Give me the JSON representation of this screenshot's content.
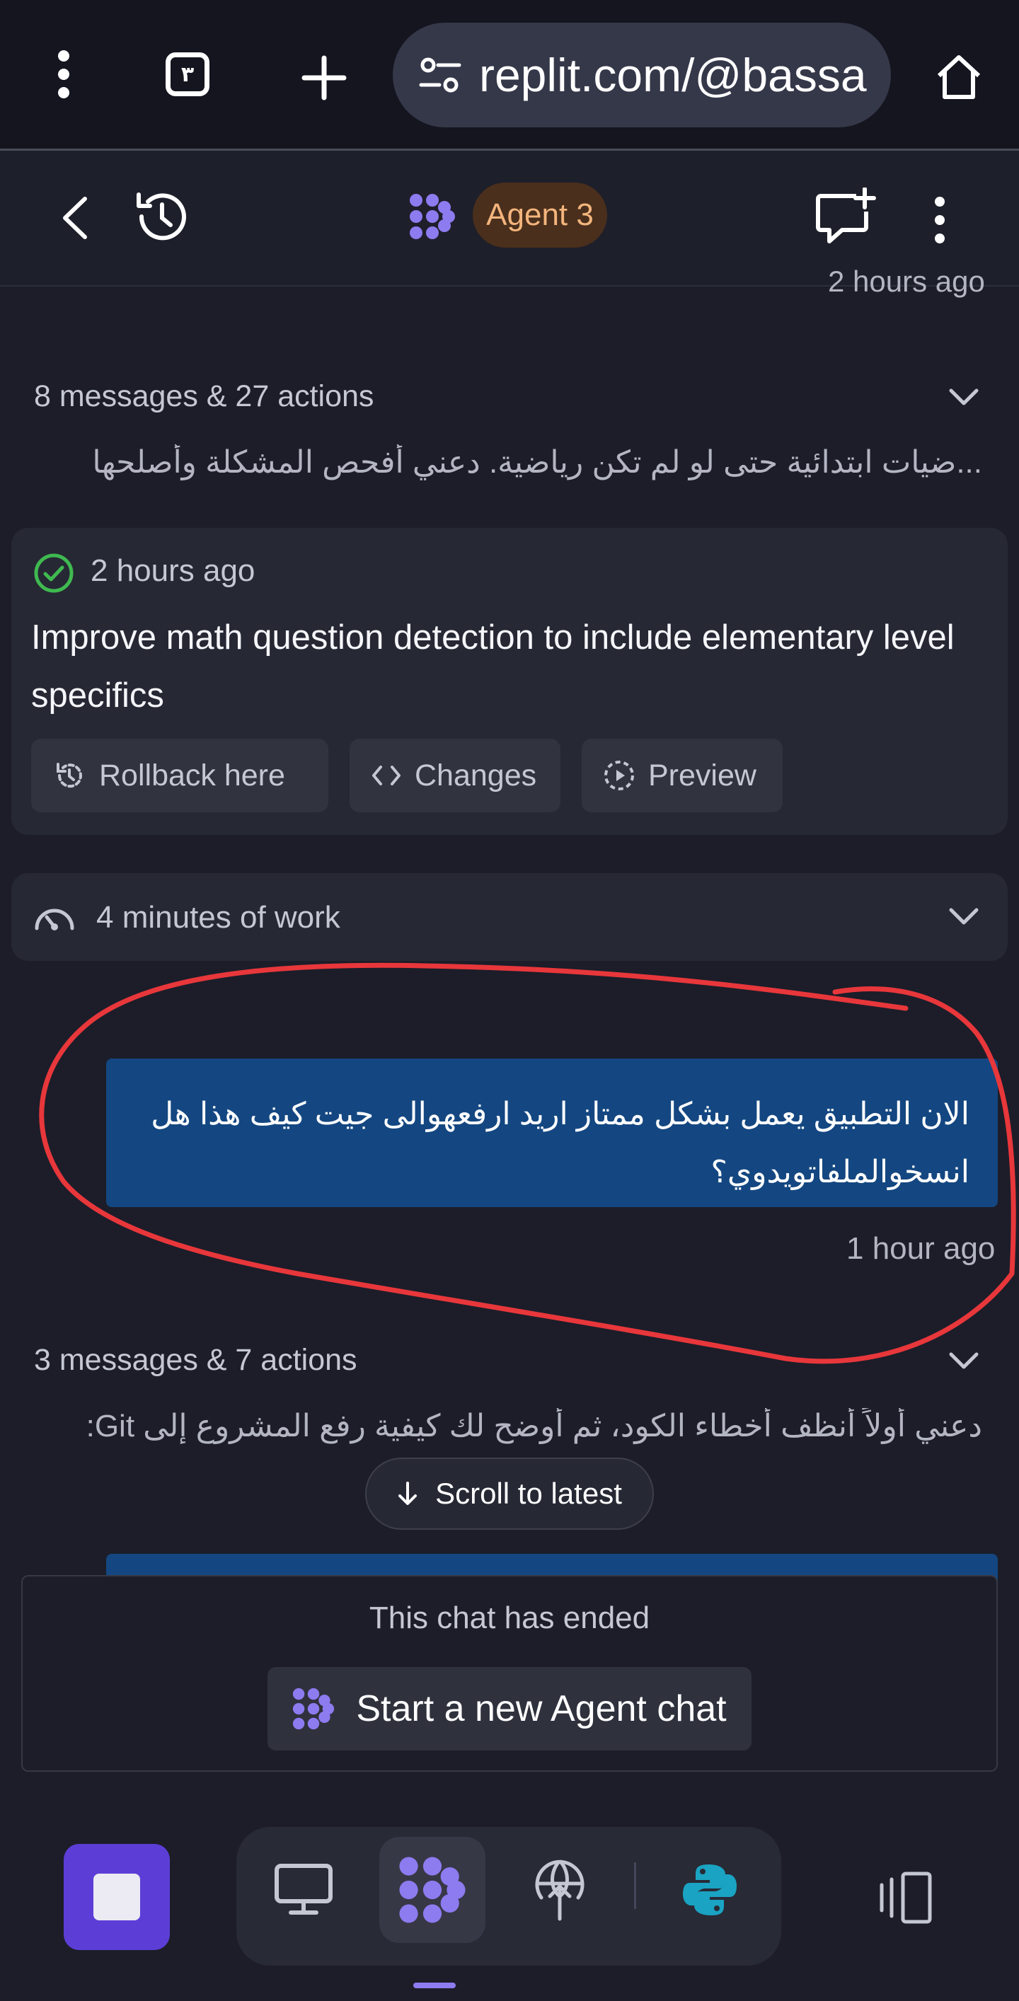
{
  "browser": {
    "tab_count": "٣",
    "url": "replit.com/@bassa"
  },
  "agent_header": {
    "title": "Agent 3"
  },
  "chat": {
    "partial_timestamp": "2 hours ago",
    "group1": {
      "summary": "8 messages & 27 actions",
      "preview": "...ضيات ابتدائية حتى لو لم تكن رياضية. دعني أفحص المشكلة وأصلحها"
    },
    "checkpoint": {
      "time": "2 hours ago",
      "title": "Improve math question detection to include elementary level specifics",
      "rollback_label": "Rollback here",
      "changes_label": "Changes",
      "preview_label": "Preview"
    },
    "work_summary": "4 minutes of work",
    "user_message": {
      "text": "الان التطبيق يعمل بشكل ممتاز اريد ارفعهوالى جيت كيف هذا هل انسخوالملفاتويدوي؟",
      "time": "1 hour ago"
    },
    "group2": {
      "summary": "3 messages & 7 actions",
      "preview": "دعني أولاً أنظف أخطاء الكود، ثم أوضح لك كيفية رفع المشروع إلى Git:"
    },
    "scroll_label": "Scroll to latest"
  },
  "ended_panel": {
    "message": "This chat has ended",
    "start_label": "Start a new Agent chat"
  },
  "colors": {
    "background": "#1c1d29",
    "card": "#262834",
    "user_bubble": "#144781",
    "agent_badge_bg": "#4a2f1c",
    "agent_badge_text": "#f3b57d",
    "agent_purple": "#8d7bf0",
    "stop_button": "#5c3ed6",
    "success_green": "#3fb950",
    "annotation_red": "#e8373b"
  }
}
